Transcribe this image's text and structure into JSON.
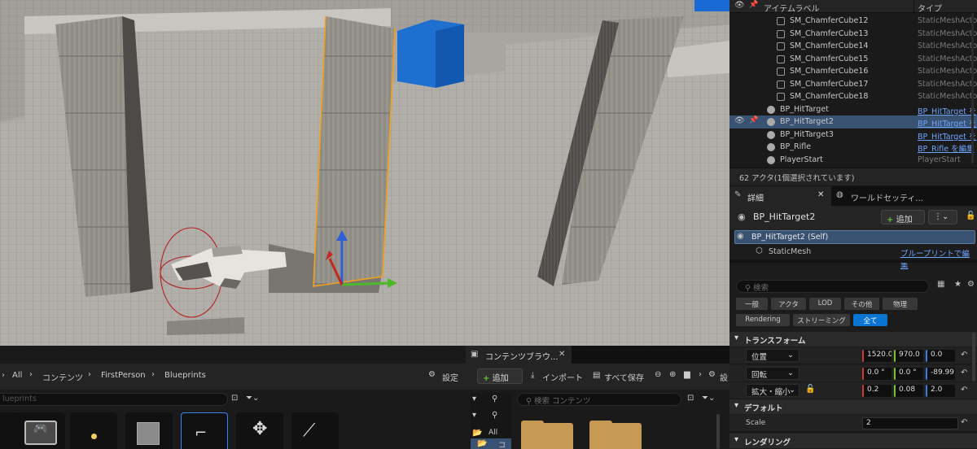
{
  "outliner": {
    "col_label": "アイテムラベル",
    "col_type": "タイプ",
    "rows": [
      {
        "name": "SM_ChamferCube12",
        "type": "StaticMeshActo",
        "link": false
      },
      {
        "name": "SM_ChamferCube13",
        "type": "StaticMeshActo",
        "link": false
      },
      {
        "name": "SM_ChamferCube14",
        "type": "StaticMeshActo",
        "link": false
      },
      {
        "name": "SM_ChamferCube15",
        "type": "StaticMeshActo",
        "link": false
      },
      {
        "name": "SM_ChamferCube16",
        "type": "StaticMeshActo",
        "link": false
      },
      {
        "name": "SM_ChamferCube17",
        "type": "StaticMeshActo",
        "link": false
      },
      {
        "name": "SM_ChamferCube18",
        "type": "StaticMeshActo",
        "link": false
      },
      {
        "name": "BP_HitTarget",
        "type": "BP_HitTarget を",
        "link": true
      },
      {
        "name": "BP_HitTarget2",
        "type": "BP_HitTarget を",
        "link": true,
        "selected": true
      },
      {
        "name": "BP_HitTarget3",
        "type": "BP_HitTarget を",
        "link": true
      },
      {
        "name": "BP_Rifle",
        "type": "BP_Rifle を編集",
        "link": true
      },
      {
        "name": "PlayerStart",
        "type": "PlayerStart",
        "link": false
      }
    ],
    "count_text": "62 アクタ(1個選択されています)"
  },
  "details": {
    "tab_details": "詳細",
    "tab_world": "ワールドセッティ...",
    "actor_name": "BP_HitTarget2",
    "add_label": "追加",
    "self_label": "BP_HitTarget2 (Self)",
    "component": "StaticMesh",
    "blueprint_link": "ブループリントで編集",
    "search_placeholder": "検索",
    "filters": [
      "一般",
      "アクタ",
      "LOD",
      "その他",
      "物理",
      "Rendering",
      "ストリーミング",
      "全て"
    ],
    "transform_section": "トランスフォーム",
    "location_label": "位置",
    "location": [
      "1520.0",
      "970.0",
      "0.0"
    ],
    "rotation_label": "回転",
    "rotation": [
      "0.0 °",
      "0.0 °",
      "-89.99"
    ],
    "scale_label": "拡大・縮小",
    "scale": [
      "0.2",
      "0.08",
      "2.0"
    ],
    "default_section": "デフォルト",
    "scale_prop_label": "Scale",
    "scale_prop_value": "2",
    "rendering_section": "レンダリング"
  },
  "content_left": {
    "path": [
      "All",
      "コンテンツ",
      "FirstPerson",
      "Blueprints"
    ],
    "settings": "設定",
    "search_value": "lueprints"
  },
  "content_right": {
    "tab": "コンテンツブラウ...",
    "add": "追加",
    "import": "インポート",
    "save_all": "すべて保存",
    "settings": "設",
    "search_placeholder": "検索 コンテンツ",
    "tree_all": "All",
    "tree_content": "コ"
  },
  "colors": {
    "accent": "#0a75d1",
    "selected_row": "#3a5272",
    "link": "#6ea5ff",
    "add_plus": "#5fc23b"
  }
}
